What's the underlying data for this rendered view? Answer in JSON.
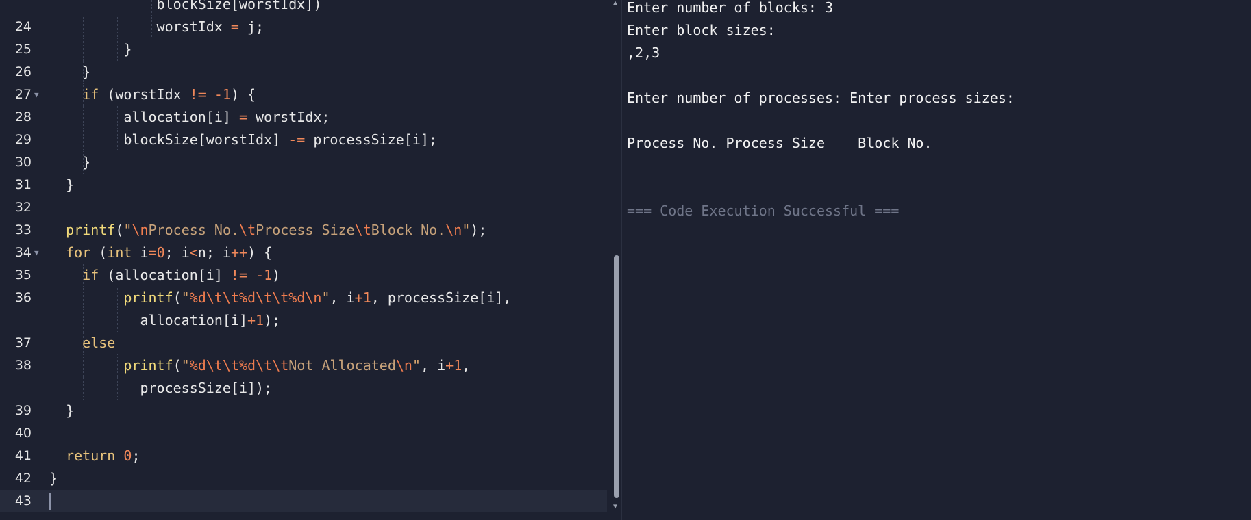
{
  "editor": {
    "lines": [
      {
        "num": "",
        "fold": false,
        "guides": [
          3
        ],
        "text": "            blockSize[worstIdx])"
      },
      {
        "num": "24",
        "fold": false,
        "guides": [
          1,
          2,
          3
        ],
        "text": "            worstIdx = j;"
      },
      {
        "num": "25",
        "fold": false,
        "guides": [
          1,
          2
        ],
        "text": "        }"
      },
      {
        "num": "26",
        "fold": false,
        "guides": [
          1
        ],
        "text": "    }"
      },
      {
        "num": "27",
        "fold": true,
        "guides": [
          1
        ],
        "text": "    if (worstIdx != -1) {"
      },
      {
        "num": "28",
        "fold": false,
        "guides": [
          1,
          2
        ],
        "text": "        allocation[i] = worstIdx;"
      },
      {
        "num": "29",
        "fold": false,
        "guides": [
          1,
          2
        ],
        "text": "        blockSize[worstIdx] -= processSize[i];"
      },
      {
        "num": "30",
        "fold": false,
        "guides": [
          1
        ],
        "text": "    }"
      },
      {
        "num": "31",
        "fold": false,
        "guides": [],
        "text": "  }"
      },
      {
        "num": "32",
        "fold": false,
        "guides": [],
        "text": ""
      },
      {
        "num": "33",
        "fold": false,
        "guides": [],
        "text": "  printf(\"\\nProcess No.\\tProcess Size\\tBlock No.\\n\");"
      },
      {
        "num": "34",
        "fold": true,
        "guides": [],
        "text": "  for (int i=0; i<n; i++) {"
      },
      {
        "num": "35",
        "fold": false,
        "guides": [
          1
        ],
        "text": "    if (allocation[i] != -1)"
      },
      {
        "num": "36",
        "fold": false,
        "guides": [
          1,
          2
        ],
        "text": "        printf(\"%d\\t\\t%d\\t\\t%d\\n\", i+1, processSize[i],"
      },
      {
        "num": "",
        "fold": false,
        "guides": [
          1,
          2
        ],
        "text": "          allocation[i]+1);"
      },
      {
        "num": "37",
        "fold": false,
        "guides": [
          1
        ],
        "text": "    else"
      },
      {
        "num": "38",
        "fold": false,
        "guides": [
          1,
          2
        ],
        "text": "        printf(\"%d\\t\\t%d\\t\\tNot Allocated\\n\", i+1,"
      },
      {
        "num": "",
        "fold": false,
        "guides": [
          1,
          2
        ],
        "text": "          processSize[i]);"
      },
      {
        "num": "39",
        "fold": false,
        "guides": [],
        "text": "  }"
      },
      {
        "num": "40",
        "fold": false,
        "guides": [],
        "text": ""
      },
      {
        "num": "41",
        "fold": false,
        "guides": [],
        "text": "  return 0;"
      },
      {
        "num": "42",
        "fold": false,
        "guides": [],
        "text": "}"
      },
      {
        "num": "43",
        "fold": false,
        "guides": [],
        "text": "",
        "active": true
      }
    ]
  },
  "output": {
    "lines": [
      "Enter number of blocks: 3",
      "Enter block sizes:",
      ",2,3",
      "",
      "Enter number of processes: Enter process sizes:",
      "",
      "Process No. Process Size    Block No.",
      "",
      "",
      "=== Code Execution Successful ==="
    ]
  },
  "icons": {
    "fold_marker": "chevron-down-icon",
    "scroll_up": "scroll-up-arrow-icon",
    "scroll_down": "scroll-down-arrow-icon"
  }
}
